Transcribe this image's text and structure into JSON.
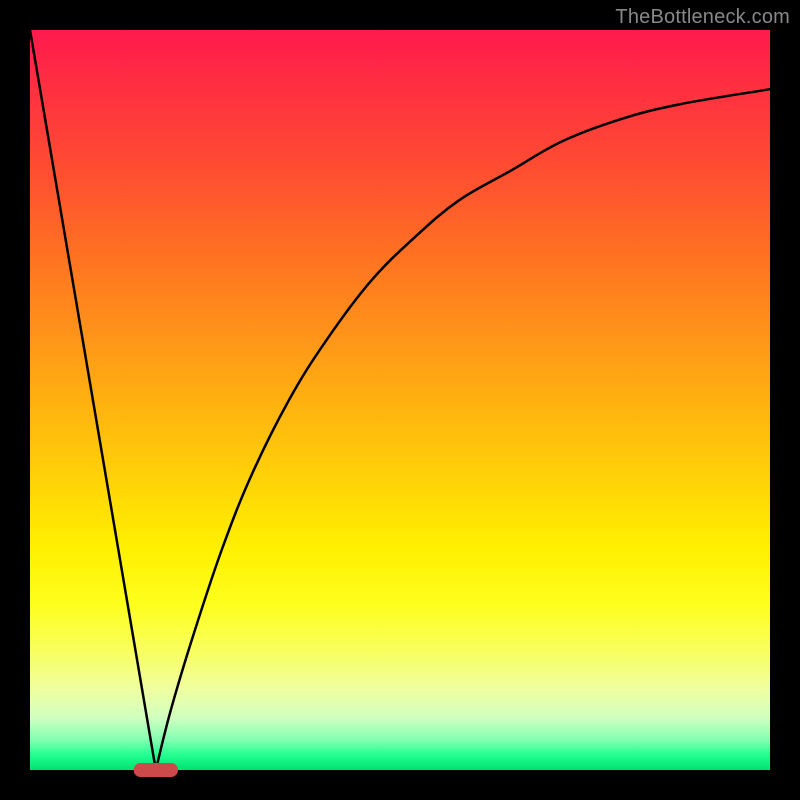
{
  "watermark": "TheBottleneck.com",
  "chart_data": {
    "type": "line",
    "title": "",
    "xlabel": "",
    "ylabel": "",
    "xlim": [
      0,
      100
    ],
    "ylim": [
      0,
      100
    ],
    "series": [
      {
        "name": "left-branch",
        "x": [
          0,
          17
        ],
        "y": [
          100,
          0
        ]
      },
      {
        "name": "right-branch",
        "x": [
          17,
          19,
          22,
          26,
          30,
          35,
          40,
          46,
          52,
          58,
          65,
          72,
          80,
          88,
          100
        ],
        "y": [
          0,
          8,
          18,
          30,
          40,
          50,
          58,
          66,
          72,
          77,
          81,
          85,
          88,
          90,
          92
        ]
      }
    ],
    "marker": {
      "name": "minimum-marker",
      "x": 17,
      "y": 0,
      "width_pct": 6,
      "color": "#cc4a4a"
    },
    "colors": {
      "curve": "#000000",
      "gradient_top": "#ff1a4d",
      "gradient_mid": "#fff000",
      "gradient_bottom": "#00e070",
      "frame": "#000000"
    }
  }
}
